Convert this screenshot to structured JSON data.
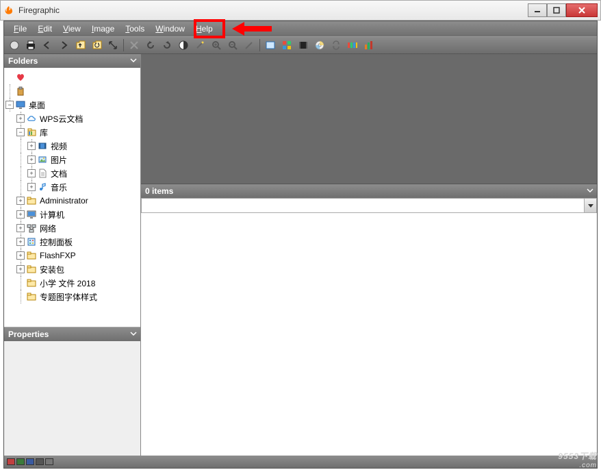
{
  "window": {
    "title": "Firegraphic"
  },
  "menus": {
    "file": "File",
    "edit": "Edit",
    "view": "View",
    "image": "Image",
    "tools": "Tools",
    "window": "Window",
    "help": "Help"
  },
  "panels": {
    "folders": "Folders",
    "properties": "Properties",
    "items_status": "0 items"
  },
  "tree": {
    "favorites": "",
    "clipboard": "",
    "desktop": "桌面",
    "wps": "WPS云文档",
    "library": "库",
    "video": "视频",
    "pictures": "图片",
    "documents": "文档",
    "music": "音乐",
    "admin": "Administrator",
    "computer": "计算机",
    "network": "网络",
    "control": "控制面板",
    "flashfxp": "FlashFXP",
    "install": "安装包",
    "school": "小学 文件 2018",
    "fontstyle": "专题图字体样式"
  },
  "status_colors": [
    "#c04040",
    "#3a7a3a",
    "#3a5aa0",
    "#555555",
    "#777777"
  ],
  "watermark": {
    "main": "9553下载",
    "sub": ".com"
  }
}
